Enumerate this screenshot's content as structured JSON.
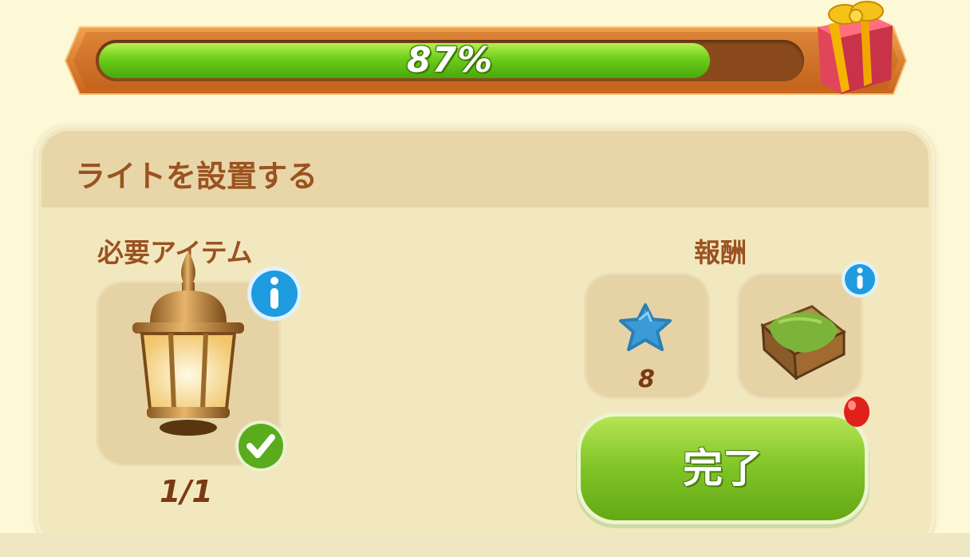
{
  "progress": {
    "label": "87%",
    "value": 0.87
  },
  "panel": {
    "title": "ライトを設置する",
    "required": {
      "heading": "必要アイテム",
      "item_icon": "lantern-icon",
      "count": "1/1",
      "completed": true
    },
    "reward": {
      "heading": "報酬",
      "items": [
        {
          "icon": "blue-star-icon",
          "amount": "8"
        },
        {
          "icon": "grass-crate-icon",
          "amount": ""
        }
      ]
    },
    "done_button": {
      "label": "完了"
    }
  },
  "colors": {
    "background": "#fdf8d6",
    "progress_green": "#6ccd1a",
    "title_brown": "#9a5320",
    "button_green": "#7fc426",
    "info_blue": "#1f9be0",
    "notification_red": "#e0201a"
  }
}
